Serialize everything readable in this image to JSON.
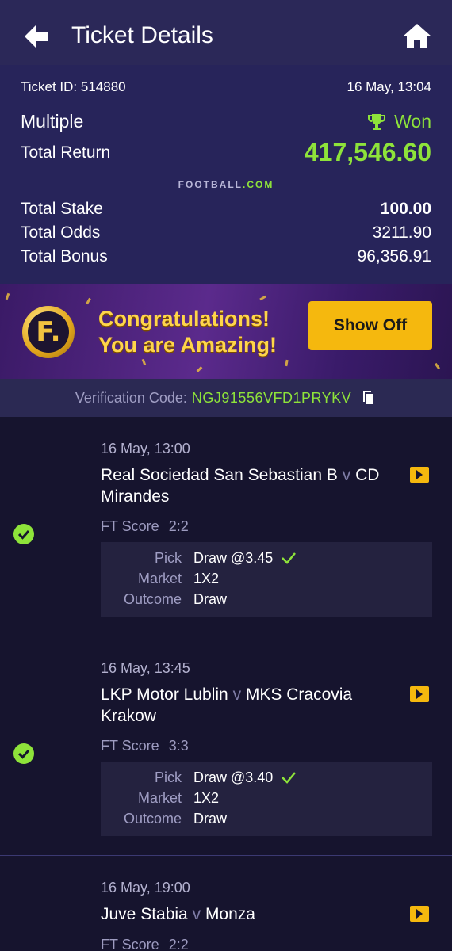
{
  "header": {
    "title": "Ticket Details",
    "back_icon": "arrow-left-icon",
    "home_icon": "home-icon"
  },
  "summary": {
    "ticket_id": "Ticket ID: 514880",
    "datetime": "16 May, 13:04",
    "bet_type": "Multiple",
    "status": "Won",
    "total_return_label": "Total Return",
    "total_return": "417,546.60",
    "brand": "FOOTBALL",
    "brand_tld": ".COM",
    "total_stake_label": "Total Stake",
    "total_stake": "100.00",
    "total_odds_label": "Total Odds",
    "total_odds": "3211.90",
    "total_bonus_label": "Total Bonus",
    "total_bonus": "96,356.91"
  },
  "banner": {
    "logo_letter": "F.",
    "line1": "Congratulations!",
    "line2": "You are Amazing!",
    "button": "Show Off"
  },
  "verification": {
    "label": "Verification Code:",
    "code": "NGJ91556VFD1PRYKV"
  },
  "events": [
    {
      "date": "16 May, 13:00",
      "home": "Real Sociedad San Sebastian B",
      "v": "v",
      "away": "CD Mirandes",
      "score_label": "FT Score",
      "score": "2:2",
      "pick_label": "Pick",
      "pick": "Draw @3.45",
      "market_label": "Market",
      "market": "1X2",
      "outcome_label": "Outcome",
      "outcome": "Draw"
    },
    {
      "date": "16 May, 13:45",
      "home": "LKP Motor Lublin",
      "v": "v",
      "away": "MKS Cracovia Krakow",
      "score_label": "FT Score",
      "score": "3:3",
      "pick_label": "Pick",
      "pick": "Draw @3.40",
      "market_label": "Market",
      "market": "1X2",
      "outcome_label": "Outcome",
      "outcome": "Draw"
    },
    {
      "date": "16 May, 19:00",
      "home": "Juve Stabia",
      "v": "v",
      "away": "Monza",
      "score_label": "FT Score",
      "score": "2:2"
    }
  ],
  "colors": {
    "accent_green": "#8ee33a",
    "header_bg": "#2b2858",
    "button_yellow": "#f5b80e"
  }
}
